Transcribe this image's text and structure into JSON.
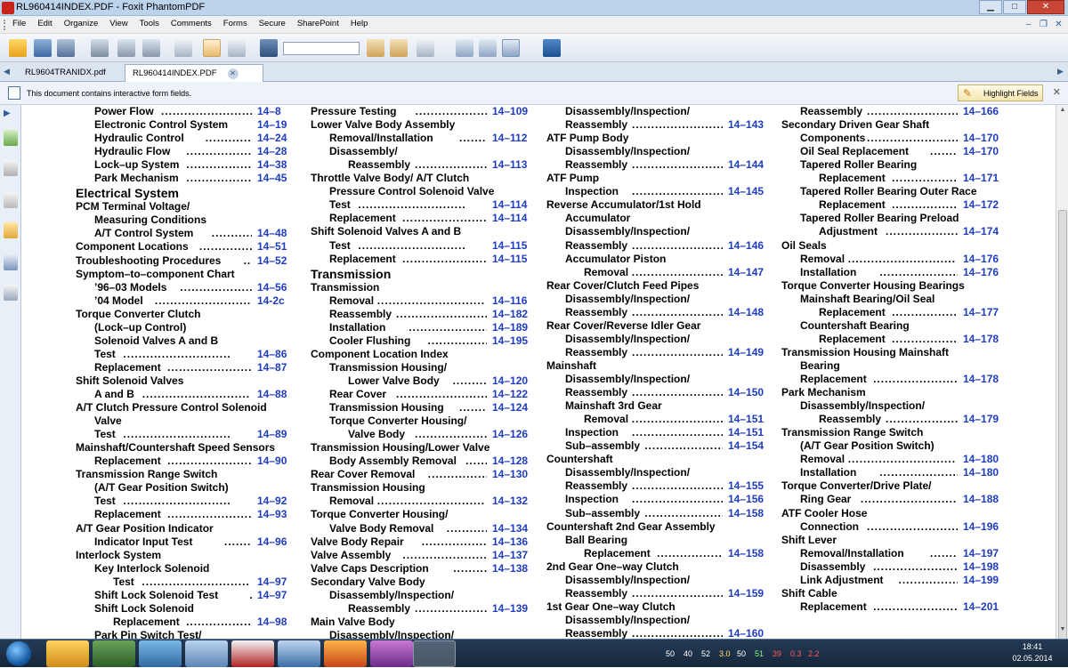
{
  "window": {
    "title": "RL960414INDEX.PDF - Foxit PhantomPDF"
  },
  "menu": [
    "File",
    "Edit",
    "Organize",
    "View",
    "Tools",
    "Comments",
    "Forms",
    "Secure",
    "SharePoint",
    "Help"
  ],
  "tabs": [
    {
      "label": "RL9604TRANIDX.pdf",
      "active": false
    },
    {
      "label": "RL960414INDEX.PDF",
      "active": true
    }
  ],
  "form_bar": {
    "message": "This document contains interactive form fields.",
    "highlight_label": "Highlight Fields"
  },
  "search": {
    "value": ""
  },
  "columns": [
    {
      "rows": [
        {
          "t": "Power Flow",
          "p": "14–8",
          "i": 1
        },
        {
          "t": "Electronic Control System",
          "p": "14–19",
          "i": 1
        },
        {
          "t": "Hydraulic Control",
          "p": "14–24",
          "i": 1
        },
        {
          "t": "Hydraulic Flow",
          "p": "14–28",
          "i": 1
        },
        {
          "t": "Lock–up System",
          "p": "14–38",
          "i": 1
        },
        {
          "t": "Park Mechanism",
          "p": "14–45",
          "i": 1
        },
        {
          "t": "Electrical System",
          "h": 1
        },
        {
          "t": "PCM Terminal Voltage/",
          "i": 0
        },
        {
          "t": "Measuring Conditions",
          "i": 1
        },
        {
          "t": "A/T Control System",
          "p": "14–48",
          "i": 1
        },
        {
          "t": "Component Locations",
          "p": "14–51",
          "i": 0
        },
        {
          "t": "Troubleshooting Procedures",
          "p": "14–52",
          "i": 0
        },
        {
          "t": "Symptom–to–component Chart",
          "i": 0
        },
        {
          "t": "’96–03 Models",
          "p": "14–56",
          "i": 1
        },
        {
          "t": "’04 Model",
          "p": "14-2c",
          "i": 1
        },
        {
          "t": "Torque Converter Clutch",
          "i": 0
        },
        {
          "t": "(Lock–up Control)",
          "i": 1
        },
        {
          "t": "Solenoid Valves A and B",
          "i": 1
        },
        {
          "t": "Test",
          "p": "14–86",
          "i": 1
        },
        {
          "t": "Replacement",
          "p": "14–87",
          "i": 1
        },
        {
          "t": "Shift Solenoid Valves",
          "i": 0
        },
        {
          "t": "A and B",
          "p": "14–88",
          "i": 1
        },
        {
          "t": "A/T Clutch Pressure Control Solenoid",
          "i": 0
        },
        {
          "t": "Valve",
          "i": 1
        },
        {
          "t": "Test",
          "p": "14–89",
          "i": 1
        },
        {
          "t": "Mainshaft/Countershaft Speed Sensors",
          "i": 0
        },
        {
          "t": "Replacement",
          "p": "14–90",
          "i": 1
        },
        {
          "t": "Transmission Range Switch",
          "i": 0
        },
        {
          "t": "(A/T Gear Position Switch)",
          "i": 1
        },
        {
          "t": "Test",
          "p": "14–92",
          "i": 1
        },
        {
          "t": "Replacement",
          "p": "14–93",
          "i": 1
        },
        {
          "t": "A/T Gear Position Indicator",
          "i": 0
        },
        {
          "t": "Indicator Input Test",
          "p": "14–96",
          "i": 1
        },
        {
          "t": "Interlock System",
          "i": 0
        },
        {
          "t": "Key Interlock Solenoid",
          "i": 1
        },
        {
          "t": "Test",
          "p": "14–97",
          "i": 2
        },
        {
          "t": "Shift Lock Solenoid Test",
          "p": "14–97",
          "i": 1
        },
        {
          "t": "Shift Lock Solenoid",
          "i": 1
        },
        {
          "t": "Replacement",
          "p": "14–98",
          "i": 2
        },
        {
          "t": "Park Pin Switch Test/",
          "i": 1
        }
      ]
    },
    {
      "rows": [
        {
          "t": "Pressure Testing",
          "p": "14–109",
          "i": 0
        },
        {
          "t": "Lower Valve Body Assembly",
          "i": 0
        },
        {
          "t": "Removal/Installation",
          "p": "14–112",
          "i": 1
        },
        {
          "t": "Disassembly/",
          "i": 1
        },
        {
          "t": "Reassembly",
          "p": "14–113",
          "i": 2
        },
        {
          "t": "Throttle Valve Body/ A/T Clutch",
          "i": 0
        },
        {
          "t": "Pressure Control Solenoid Valve",
          "i": 1
        },
        {
          "t": "Test",
          "p": "14–114",
          "i": 1
        },
        {
          "t": "Replacement",
          "p": "14–114",
          "i": 1
        },
        {
          "t": "Shift Solenoid Valves A and B",
          "i": 0
        },
        {
          "t": "Test",
          "p": "14–115",
          "i": 1
        },
        {
          "t": "Replacement",
          "p": "14–115",
          "i": 1
        },
        {
          "t": "Transmission",
          "h": 1
        },
        {
          "t": "Transmission",
          "i": 0
        },
        {
          "t": "Removal",
          "p": "14–116",
          "i": 1
        },
        {
          "t": "Reassembly",
          "p": "14–182",
          "i": 1
        },
        {
          "t": "Installation",
          "p": "14–189",
          "i": 1
        },
        {
          "t": "Cooler Flushing",
          "p": "14–195",
          "i": 1
        },
        {
          "t": "Component Location Index",
          "i": 0
        },
        {
          "t": "Transmission Housing/",
          "i": 1
        },
        {
          "t": "Lower Valve Body",
          "p": "14–120",
          "i": 2
        },
        {
          "t": "Rear Cover",
          "p": "14–122",
          "i": 1
        },
        {
          "t": "Transmission Housing",
          "p": "14–124",
          "i": 1
        },
        {
          "t": "Torque Converter Housing/",
          "i": 1
        },
        {
          "t": "Valve Body",
          "p": "14–126",
          "i": 2
        },
        {
          "t": "Transmission Housing/Lower Valve",
          "i": 0
        },
        {
          "t": "Body Assembly Removal",
          "p": "14–128",
          "i": 1
        },
        {
          "t": "Rear Cover Removal",
          "p": "14–130",
          "i": 0
        },
        {
          "t": "Transmission Housing",
          "i": 0
        },
        {
          "t": "Removal",
          "p": "14–132",
          "i": 1
        },
        {
          "t": "Torque Converter Housing/",
          "i": 0
        },
        {
          "t": "Valve Body Removal",
          "p": "14–134",
          "i": 1
        },
        {
          "t": "Valve Body Repair",
          "p": "14–136",
          "i": 0
        },
        {
          "t": "Valve Assembly",
          "p": "14–137",
          "i": 0
        },
        {
          "t": "Valve Caps Description",
          "p": "14–138",
          "i": 0
        },
        {
          "t": "Secondary Valve Body",
          "i": 0
        },
        {
          "t": "Disassembly/Inspection/",
          "i": 1
        },
        {
          "t": "Reassembly",
          "p": "14–139",
          "i": 2
        },
        {
          "t": "Main Valve Body",
          "i": 0
        },
        {
          "t": "Disassembly/Inspection/",
          "i": 1
        }
      ]
    },
    {
      "rows": [
        {
          "t": "Disassembly/Inspection/",
          "i": 1
        },
        {
          "t": "Reassembly",
          "p": "14–143",
          "i": 1
        },
        {
          "t": "ATF Pump Body",
          "i": 0
        },
        {
          "t": "Disassembly/Inspection/",
          "i": 1
        },
        {
          "t": "Reassembly",
          "p": "14–144",
          "i": 1
        },
        {
          "t": "ATF Pump",
          "i": 0
        },
        {
          "t": "Inspection",
          "p": "14–145",
          "i": 1
        },
        {
          "t": "Reverse Accumulator/1st Hold",
          "i": 0
        },
        {
          "t": "Accumulator",
          "i": 1
        },
        {
          "t": "Disassembly/Inspection/",
          "i": 1
        },
        {
          "t": "Reassembly",
          "p": "14–146",
          "i": 1
        },
        {
          "t": "Accumulator Piston",
          "i": 1
        },
        {
          "t": "Removal",
          "p": "14–147",
          "i": 2
        },
        {
          "t": "Rear Cover/Clutch Feed Pipes",
          "i": 0
        },
        {
          "t": "Disassembly/Inspection/",
          "i": 1
        },
        {
          "t": "Reassembly",
          "p": "14–148",
          "i": 1
        },
        {
          "t": "Rear Cover/Reverse Idler Gear",
          "i": 0
        },
        {
          "t": "Disassembly/Inspection/",
          "i": 1
        },
        {
          "t": "Reassembly",
          "p": "14–149",
          "i": 1
        },
        {
          "t": "Mainshaft",
          "i": 0
        },
        {
          "t": "Disassembly/Inspection/",
          "i": 1
        },
        {
          "t": "Reassembly",
          "p": "14–150",
          "i": 1
        },
        {
          "t": "Mainshaft 3rd Gear",
          "i": 1
        },
        {
          "t": "Removal",
          "p": "14–151",
          "i": 2
        },
        {
          "t": "Inspection",
          "p": "14–151",
          "i": 1
        },
        {
          "t": "Sub–assembly",
          "p": "14–154",
          "i": 1
        },
        {
          "t": "Countershaft",
          "i": 0
        },
        {
          "t": "Disassembly/Inspection/",
          "i": 1
        },
        {
          "t": "Reassembly",
          "p": "14–155",
          "i": 1
        },
        {
          "t": "Inspection",
          "p": "14–156",
          "i": 1
        },
        {
          "t": "Sub–assembly",
          "p": "14–158",
          "i": 1
        },
        {
          "t": "Countershaft 2nd Gear Assembly",
          "i": 0
        },
        {
          "t": "Ball Bearing",
          "i": 1
        },
        {
          "t": "Replacement",
          "p": "14–158",
          "i": 2
        },
        {
          "t": "2nd Gear One–way Clutch",
          "i": 0
        },
        {
          "t": "Disassembly/Inspection/",
          "i": 1
        },
        {
          "t": "Reassembly",
          "p": "14–159",
          "i": 1
        },
        {
          "t": "1st Gear One–way Clutch",
          "i": 0
        },
        {
          "t": "Disassembly/Inspection/",
          "i": 1
        },
        {
          "t": "Reassembly",
          "p": "14–160",
          "i": 1
        }
      ]
    },
    {
      "rows": [
        {
          "t": "Reassembly",
          "p": "14–166",
          "i": 1
        },
        {
          "t": "Secondary Driven Gear Shaft",
          "i": 0
        },
        {
          "t": "Components",
          "p": "14–170",
          "i": 1
        },
        {
          "t": "Oil Seal Replacement",
          "p": "14–170",
          "i": 1
        },
        {
          "t": "Tapered Roller Bearing",
          "i": 1
        },
        {
          "t": "Replacement",
          "p": "14–171",
          "i": 2
        },
        {
          "t": "Tapered Roller Bearing Outer Race",
          "i": 1
        },
        {
          "t": "Replacement",
          "p": "14–172",
          "i": 2
        },
        {
          "t": "Tapered Roller Bearing Preload",
          "i": 1
        },
        {
          "t": "Adjustment",
          "p": "14–174",
          "i": 2
        },
        {
          "t": "Oil Seals",
          "i": 0
        },
        {
          "t": "Removal",
          "p": "14–176",
          "i": 1
        },
        {
          "t": "Installation",
          "p": "14–176",
          "i": 1
        },
        {
          "t": "Torque Converter Housing Bearings",
          "i": 0
        },
        {
          "t": "Mainshaft Bearing/Oil Seal",
          "i": 1
        },
        {
          "t": "Replacement",
          "p": "14–177",
          "i": 2
        },
        {
          "t": "Countershaft Bearing",
          "i": 1
        },
        {
          "t": "Replacement",
          "p": "14–178",
          "i": 2
        },
        {
          "t": "Transmission Housing Mainshaft",
          "i": 0
        },
        {
          "t": "Bearing",
          "i": 1
        },
        {
          "t": "Replacement",
          "p": "14–178",
          "i": 1
        },
        {
          "t": "Park Mechanism",
          "i": 0
        },
        {
          "t": "Disassembly/Inspection/",
          "i": 1
        },
        {
          "t": "Reassembly",
          "p": "14–179",
          "i": 2
        },
        {
          "t": "Transmission Range Switch",
          "i": 0
        },
        {
          "t": "(A/T Gear Position Switch)",
          "i": 1
        },
        {
          "t": "Removal",
          "p": "14–180",
          "i": 1
        },
        {
          "t": "Installation",
          "p": "14–180",
          "i": 1
        },
        {
          "t": "Torque Converter/Drive Plate/",
          "i": 0
        },
        {
          "t": "Ring Gear",
          "p": "14–188",
          "i": 1
        },
        {
          "t": "ATF Cooler Hose",
          "i": 0
        },
        {
          "t": "Connection",
          "p": "14–196",
          "i": 1
        },
        {
          "t": "Shift Lever",
          "i": 0
        },
        {
          "t": "Removal/Installation",
          "p": "14–197",
          "i": 1
        },
        {
          "t": "Disassembly",
          "p": "14–198",
          "i": 1
        },
        {
          "t": "Link Adjustment",
          "p": "14–199",
          "i": 1
        },
        {
          "t": "Shift Cable",
          "i": 0
        },
        {
          "t": "Replacement",
          "p": "14–201",
          "i": 1
        }
      ]
    }
  ],
  "tray": {
    "items": [
      "50",
      "40",
      "52",
      "3.0",
      "50",
      "51",
      "39",
      "0.3",
      "2.2"
    ]
  },
  "clock": {
    "time": "18:41",
    "date": "02.05.2014"
  }
}
